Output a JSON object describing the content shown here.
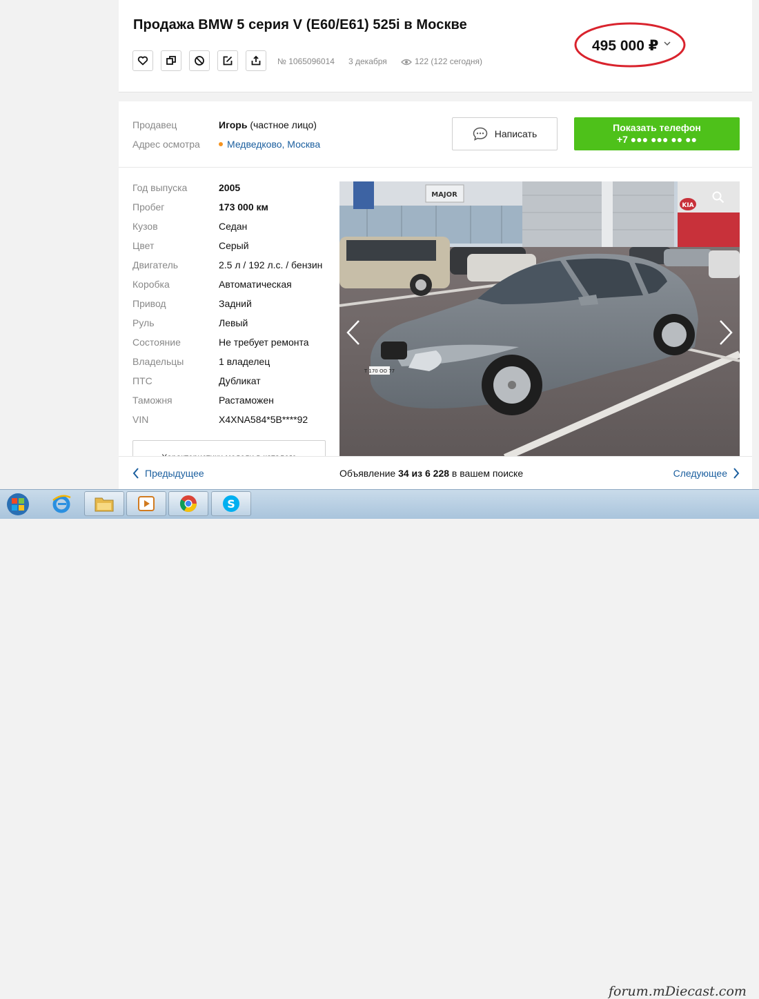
{
  "listing": {
    "title": "Продажа BMW 5 серия V (E60/E61) 525i в Москве",
    "number": "№ 1065096014",
    "date": "3 декабря",
    "views": "122 (122 сегодня)",
    "price": "495 000 ₽"
  },
  "actions": [
    {
      "name": "favorite-button",
      "icon": "heart-icon"
    },
    {
      "name": "compare-button",
      "icon": "copy-icon"
    },
    {
      "name": "block-button",
      "icon": "block-icon"
    },
    {
      "name": "note-button",
      "icon": "edit-icon"
    },
    {
      "name": "share-button",
      "icon": "share-icon"
    }
  ],
  "seller": {
    "seller_label": "Продавец",
    "seller_name": "Игорь",
    "seller_type": "(частное лицо)",
    "address_label": "Адрес осмотра",
    "address_value": "Медведково, Москва",
    "write_label": "Написать",
    "phone_label": "Показать телефон",
    "phone_masked": "+7 ●●● ●●● ●● ●●"
  },
  "specs": [
    {
      "label": "Год выпуска",
      "value": "2005",
      "bold": true
    },
    {
      "label": "Пробег",
      "value": "173 000 км",
      "bold": true
    },
    {
      "label": "Кузов",
      "value": "Седан",
      "bold": false
    },
    {
      "label": "Цвет",
      "value": "Серый",
      "bold": false
    },
    {
      "label": "Двигатель",
      "value": "2.5 л / 192 л.с. / бензин",
      "bold": false
    },
    {
      "label": "Коробка",
      "value": "Автоматическая",
      "bold": false
    },
    {
      "label": "Привод",
      "value": "Задний",
      "bold": false
    },
    {
      "label": "Руль",
      "value": "Левый",
      "bold": false
    },
    {
      "label": "Состояние",
      "value": "Не требует ремонта",
      "bold": false
    },
    {
      "label": "Владельцы",
      "value": "1 владелец",
      "bold": false
    },
    {
      "label": "ПТС",
      "value": "Дубликат",
      "bold": false
    },
    {
      "label": "Таможня",
      "value": "Растаможен",
      "bold": false
    },
    {
      "label": "VIN",
      "value": "X4XNA584*5B****92",
      "bold": false
    }
  ],
  "catalog_button": "Характеристики модели в каталоге",
  "photo": {
    "sign_major": "MAJOR",
    "sign_kia": "KIA",
    "plate": "Т 170 ОО 77"
  },
  "pager": {
    "prev": "Предыдущее",
    "next": "Следующее",
    "text_before": "Объявление ",
    "position": "34 из 6 228",
    "text_after": " в вашем поиске"
  },
  "taskbar": {
    "items": [
      "start-button",
      "ie-icon",
      "explorer-icon",
      "media-player-icon",
      "chrome-icon",
      "skype-icon"
    ],
    "watermark": "forum.mDiecast.com"
  },
  "colors": {
    "accent_green": "#4ec11a",
    "link_blue": "#1a5e9e",
    "price_oval": "#d9232d",
    "address_dot": "#f5931f"
  }
}
